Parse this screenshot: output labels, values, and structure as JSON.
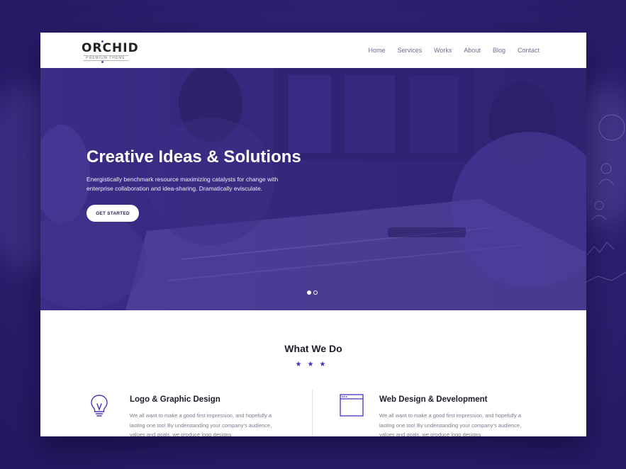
{
  "brand": {
    "logo": "ORCHID",
    "tagline": "PREMIUM THEME",
    "accent": "#4634b8",
    "hero_overlay": "#35277c"
  },
  "nav": {
    "items": [
      {
        "label": "Home"
      },
      {
        "label": "Services"
      },
      {
        "label": "Works"
      },
      {
        "label": "About"
      },
      {
        "label": "Blog"
      },
      {
        "label": "Contact"
      }
    ]
  },
  "hero": {
    "title": "Creative Ideas & Solutions",
    "subtitle": "Energistically benchmark resource maximizing catalysts for change with enterprise collaboration and idea-sharing. Dramatically evisculate.",
    "cta_label": "GET STARTED",
    "slides_total": 2,
    "active_slide": 1
  },
  "what_we_do": {
    "title": "What We Do",
    "stars": "★★★",
    "services": [
      {
        "icon": "lightbulb-icon",
        "title": "Logo & Graphic Design",
        "description": "We all want to make a good first impression, and hopefully a lasting one too! By understanding your company's audience, values and goals, we produce logo designs"
      },
      {
        "icon": "browser-window-icon",
        "title": "Web Design & Development",
        "description": "We all want to make a good first impression, and hopefully a lasting one too! By understanding your company's audience, values and goals, we produce logo designs"
      }
    ]
  }
}
